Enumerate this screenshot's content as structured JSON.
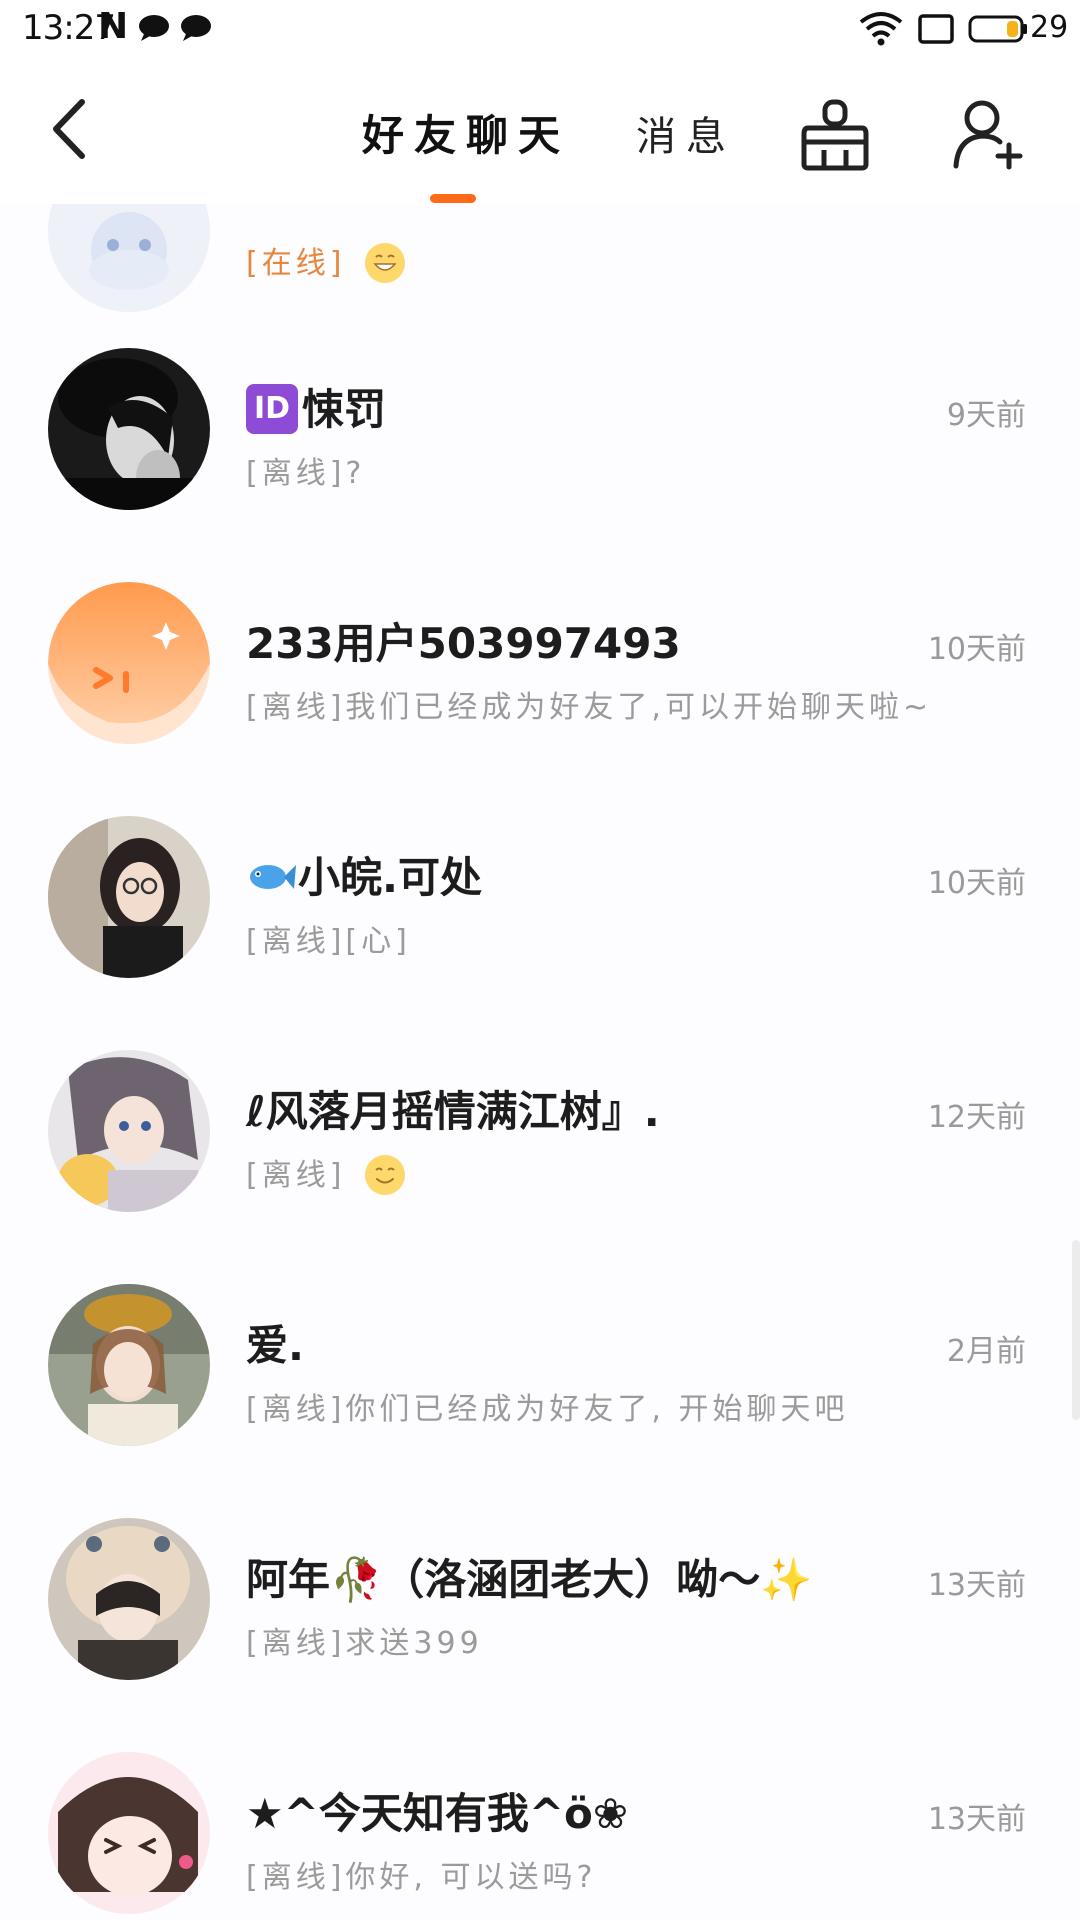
{
  "status_bar": {
    "time": "13:27",
    "n_label": "N",
    "battery_level": "29"
  },
  "nav": {
    "back_icon": "chevron-left-icon",
    "tab_friends": "好友聊天",
    "tab_messages": "消息",
    "clean_icon": "broom-icon",
    "add_friend_icon": "add-user-icon",
    "accent_color": "#ff6a1a"
  },
  "chats": [
    {
      "name": "",
      "status": "[在线]",
      "message": "",
      "time": "",
      "emoji": "grinning-face"
    },
    {
      "name_prefix_icon": "id-icon",
      "name": "悚罚",
      "status": "[离线]",
      "message": "?",
      "time": "9天前"
    },
    {
      "name": "233用户503997493",
      "status": "[离线]",
      "message": "我们已经成为好友了,可以开始聊天啦~",
      "time": "10天前"
    },
    {
      "name_prefix_icon": "fish-icon",
      "name": "小皖.可处",
      "status": "[离线]",
      "message": "[心]",
      "time": "10天前"
    },
    {
      "name": "ℓ风落月摇情满江树』.",
      "status": "[离线]",
      "message": "",
      "time": "12天前",
      "emoji": "smiling-face"
    },
    {
      "name": "爱.",
      "status": "[离线]",
      "message": "你们已经成为好友了, 开始聊天吧",
      "time": "2月前"
    },
    {
      "name": "阿年🥀（洛涵团老大）呦～✨",
      "status": "[离线]",
      "message": "求送399",
      "time": "13天前"
    },
    {
      "name": "★^今天知有我^ö❀",
      "status": "[离线]",
      "message": "你好, 可以送吗?",
      "time": "13天前"
    }
  ]
}
